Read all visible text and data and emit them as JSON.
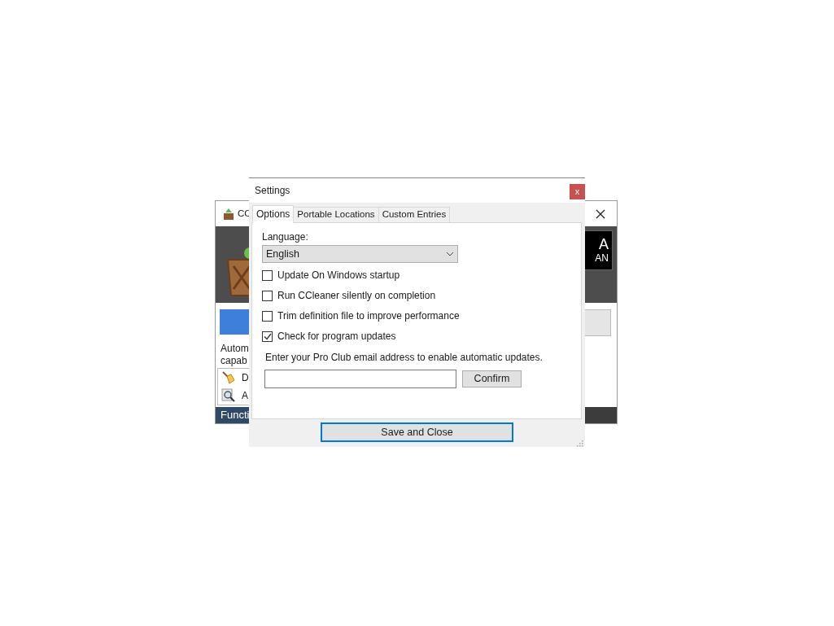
{
  "background_window": {
    "title": "CC",
    "header_badge": [
      "A",
      "AN"
    ],
    "description": [
      "Autom",
      "capab"
    ],
    "list_items": [
      {
        "kind": "broom",
        "label": "D"
      },
      {
        "kind": "magnifier",
        "label": "A"
      }
    ],
    "status_tab": "Functi"
  },
  "dialog": {
    "title": "Settings",
    "close": "x",
    "tabs": [
      {
        "label": "Options",
        "selected": true
      },
      {
        "label": "Portable Locations",
        "selected": false
      },
      {
        "label": "Custom Entries",
        "selected": false
      }
    ],
    "language_label": "Language:",
    "language_value": "English",
    "options": [
      {
        "label": "Update On Windows startup",
        "checked": false
      },
      {
        "label": "Run CCleaner silently on completion",
        "checked": false
      },
      {
        "label": "Trim definition file to improve performance",
        "checked": false
      },
      {
        "label": "Check for program updates",
        "checked": true
      }
    ],
    "email_prompt": "Enter your Pro Club email address to enable automatic updates.",
    "confirm": "Confirm",
    "save": "Save and Close"
  }
}
